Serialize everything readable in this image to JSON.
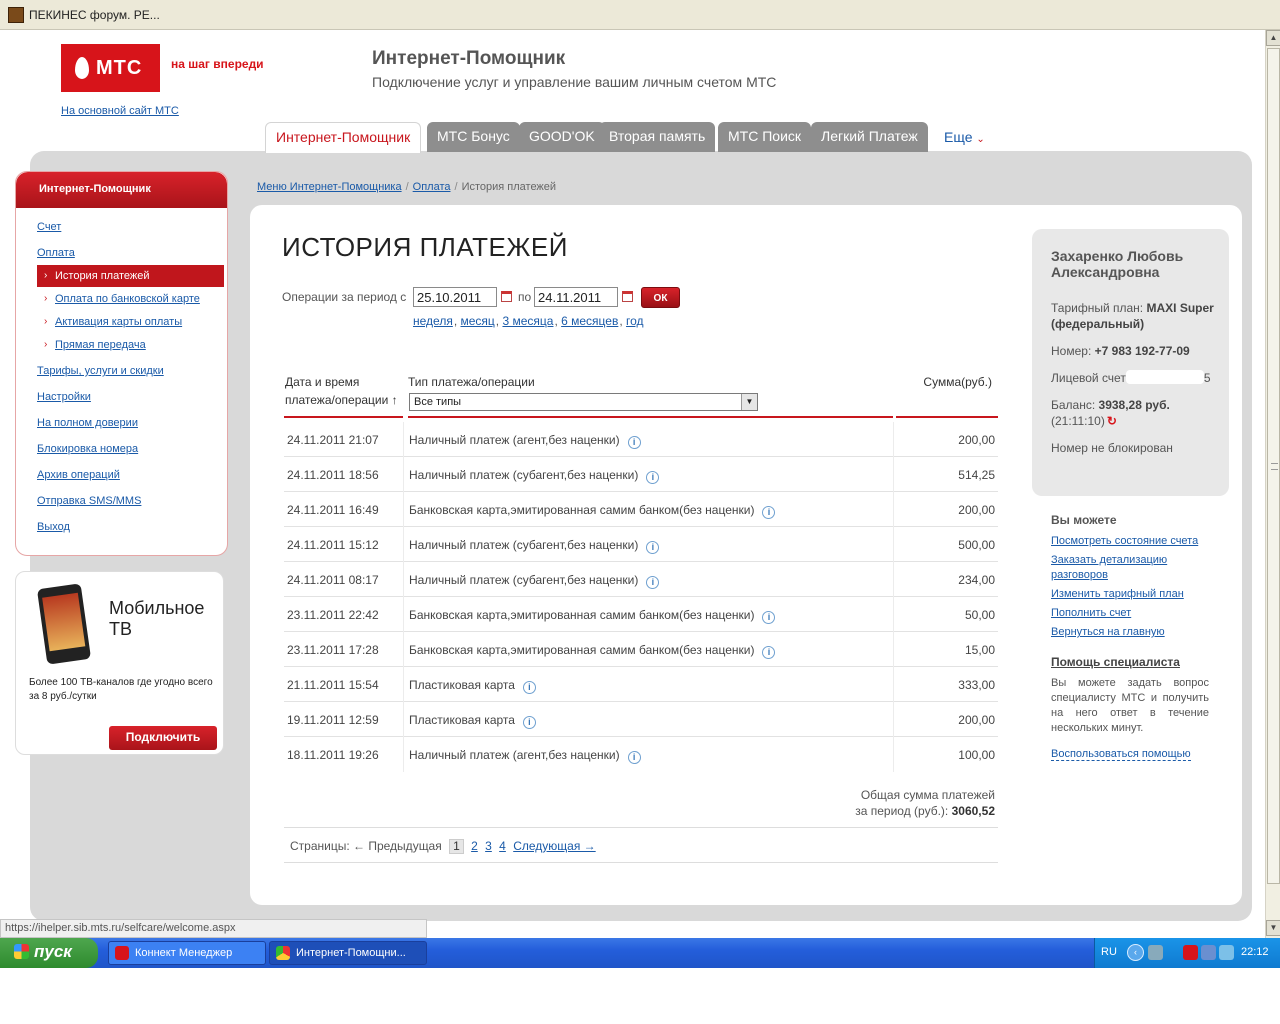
{
  "browser": {
    "tab_title": "ПЕКИНЕС форум. РЕ..."
  },
  "header": {
    "logo_text": "МТС",
    "slogan": "на шаг впереди",
    "main_site_link": "На основной сайт МТС",
    "title": "Интернет-Помощник",
    "subtitle": "Подключение услуг и управление вашим личным счетом МТС"
  },
  "top_tabs": [
    {
      "label": "Интернет-Помощник",
      "active": true
    },
    {
      "label": "МТС Бонус"
    },
    {
      "label": "GOOD'OK"
    },
    {
      "label": "Вторая память"
    },
    {
      "label": "МТС Поиск"
    },
    {
      "label": "Легкий Платеж"
    }
  ],
  "more_tab": "Еще",
  "sidebar": {
    "heading": "Интернет-Помощник",
    "items": [
      {
        "label": "Счет"
      },
      {
        "label": "Оплата"
      },
      {
        "label": "История платежей",
        "sub": true,
        "active": true
      },
      {
        "label": "Оплата по банковской карте",
        "sub": true
      },
      {
        "label": "Активация карты оплаты",
        "sub": true
      },
      {
        "label": "Прямая передача",
        "sub": true
      },
      {
        "label": "Тарифы, услуги и скидки"
      },
      {
        "label": "Настройки"
      },
      {
        "label": "На полном доверии"
      },
      {
        "label": "Блокировка номера"
      },
      {
        "label": "Архив операций"
      },
      {
        "label": "Отправка SMS/MMS"
      },
      {
        "label": "Выход"
      }
    ]
  },
  "promo": {
    "title_line1": "Мобильное",
    "title_line2": "ТВ",
    "text": "Более 100 ТВ-каналов где угодно всего за 8 руб./сутки",
    "button": "Подключить"
  },
  "breadcrumb": {
    "items": [
      "Меню Интернет-Помощника",
      "Оплата"
    ],
    "current": "История платежей",
    "separator": "/"
  },
  "page": {
    "title": "ИСТОРИЯ ПЛАТЕЖЕЙ"
  },
  "filter": {
    "period_label": "Операции за период с",
    "date_from": "25.10.2011",
    "po_label": "по",
    "date_to": "24.11.2011",
    "ok_button": "ОК",
    "quick_periods": [
      "неделя",
      "месяц",
      "3 месяца",
      "6 месяцев",
      "год"
    ]
  },
  "table": {
    "col_date_line1": "Дата и время",
    "col_date_line2": "платежа/операции ↑",
    "col_type": "Тип платежа/операции",
    "col_sum": "Сумма(руб.)",
    "type_filter_value": "Все типы",
    "rows": [
      {
        "date": "24.11.2011 21:07",
        "type": "Наличный платеж (агент,без наценки)",
        "sum": "200,00"
      },
      {
        "date": "24.11.2011 18:56",
        "type": "Наличный платеж (субагент,без наценки)",
        "sum": "514,25"
      },
      {
        "date": "24.11.2011 16:49",
        "type": "Банковская карта,эмитированная самим банком(без наценки)",
        "sum": "200,00"
      },
      {
        "date": "24.11.2011 15:12",
        "type": "Наличный платеж (субагент,без наценки)",
        "sum": "500,00"
      },
      {
        "date": "24.11.2011 08:17",
        "type": "Наличный платеж (субагент,без наценки)",
        "sum": "234,00"
      },
      {
        "date": "23.11.2011 22:42",
        "type": "Банковская карта,эмитированная самим банком(без наценки)",
        "sum": "50,00"
      },
      {
        "date": "23.11.2011 17:28",
        "type": "Банковская карта,эмитированная самим банком(без наценки)",
        "sum": "15,00"
      },
      {
        "date": "21.11.2011 15:54",
        "type": "Пластиковая карта",
        "sum": "333,00"
      },
      {
        "date": "19.11.2011 12:59",
        "type": "Пластиковая карта",
        "sum": "200,00"
      },
      {
        "date": "18.11.2011 19:26",
        "type": "Наличный платеж (агент,без наценки)",
        "sum": "100,00"
      }
    ],
    "total_line1": "Общая сумма платежей",
    "total_line2": "за период (руб.):",
    "total_value": "3060,52"
  },
  "pager": {
    "label": "Страницы:",
    "prev": "← Предыдущая",
    "current": "1",
    "pages": [
      "2",
      "3",
      "4"
    ],
    "next": "Следующая →"
  },
  "account": {
    "name": "Захаренко Любовь Александровна",
    "tariff_label": "Тарифный план:",
    "tariff_value": "MAXI Super (федеральный)",
    "number_label": "Номер:",
    "number_value": "+7 983 192-77-09",
    "account_label": "Лицевой счет",
    "account_suffix": "5",
    "balance_label": "Баланс:",
    "balance_value": "3938,28 руб.",
    "balance_time": "(21:11:10)",
    "status": "Номер не блокирован"
  },
  "you_can": {
    "title": "Вы можете",
    "links": [
      "Посмотреть состояние счета",
      "Заказать детализацию разговоров",
      "Изменить тарифный план",
      "Пополнить счет",
      "Вернуться на главную"
    ]
  },
  "help": {
    "title": "Помощь специалиста",
    "text": "Вы можете задать вопрос специалисту МТС и получить на него ответ в течение нескольких минут.",
    "link": "Воспользоваться помощью"
  },
  "statusbar": {
    "url": "https://ihelper.sib.mts.ru/selfcare/welcome.aspx"
  },
  "taskbar": {
    "start": "пуск",
    "tasks": [
      "Коннект Менеджер",
      "Интернет-Помощни..."
    ],
    "lang": "RU",
    "clock": "22:12"
  },
  "colors": {
    "brand_red": "#d7141a",
    "link_blue": "#1a5aa8",
    "panel_grey": "#d9d9d9"
  }
}
